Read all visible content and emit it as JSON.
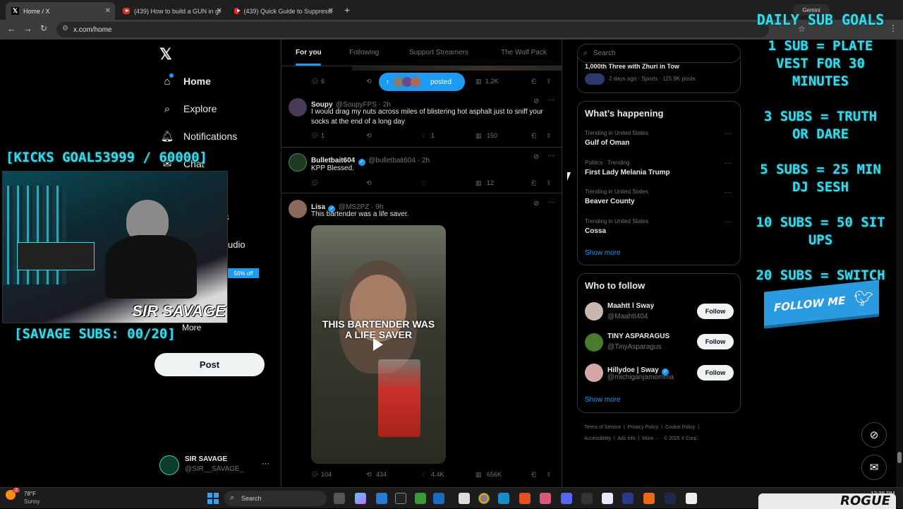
{
  "browser": {
    "tabs": [
      {
        "title": "Home / X",
        "active": true
      },
      {
        "title": "(439) How to build a GUN in gr",
        "active": false
      },
      {
        "title": "(439) Quick Guide to Suppressi",
        "active": false
      }
    ],
    "url": "x.com/home",
    "gemini_label": "Gemini"
  },
  "nav": {
    "home": "Home",
    "explore": "Explore",
    "notifications": "Notifications",
    "chat": "Chat",
    "partial_s": "s",
    "partial_udio": "udio",
    "more": "More",
    "discount_badge": "50% off",
    "post": "Post",
    "user_name": "SIR SAVAGE",
    "user_handle": "@SIR__SAVAGE_"
  },
  "feed": {
    "tabs": [
      "For you",
      "Following",
      "Support Streamers",
      "The Wolf Pack"
    ],
    "posted_pill": "posted",
    "top_actions": {
      "replies": "6",
      "views": "1.2K"
    },
    "tweets": [
      {
        "name": "Soupy",
        "handle": "@SoupyFPS · 2h",
        "text": "I would drag my nuts across miles of blistering hot asphalt just to sniff your socks at the end of a long day",
        "replies": "1",
        "reposts": "",
        "likes": "1",
        "views": "150"
      },
      {
        "name": "Bulletbait604",
        "handle": "@bulletbait604 · 2h",
        "text": "KPP Blessed.",
        "replies": "",
        "reposts": "",
        "likes": "",
        "views": "12"
      },
      {
        "name": "Lisa",
        "handle": "@MS2PZ · 9h",
        "text": "This bartender was a life saver.",
        "video_caption": "THIS BARTENDER WAS A LIFE SAVER",
        "replies": "104",
        "reposts": "434",
        "likes": "4.4K",
        "views": "656K"
      }
    ]
  },
  "right": {
    "search_placeholder": "Search",
    "top_card": {
      "title": "1,000th Three with Zhuri in Tow",
      "meta": "2 days ago · Sports · 115.9K posts"
    },
    "happening_title": "What’s happening",
    "trends": [
      {
        "meta": "Trending in United States",
        "name": "Gulf of Oman"
      },
      {
        "meta": "Politics · Trending",
        "name": "First Lady Melania Trump"
      },
      {
        "meta": "Trending in United States",
        "name": "Beaver County"
      },
      {
        "meta": "Trending in United States",
        "name": "Cossa"
      }
    ],
    "show_more": "Show more",
    "wtf_title": "Who to follow",
    "wtf": [
      {
        "name": "Maahtt l Sway",
        "handle": "@Maahtt404",
        "button": "Follow"
      },
      {
        "name": "TINY ASPARAGUS",
        "handle": "@TinyAsparagus",
        "button": "Follow"
      },
      {
        "name": "Hillydoe | Sway",
        "handle": "@michiganjamomma",
        "button": "Follow"
      }
    ],
    "wtf_show_more": "Show more",
    "footer": [
      "Terms of Service",
      "Privacy Policy",
      "Cookie Policy",
      "Accessibility",
      "Ads info",
      "More ···",
      "© 2025 X Corp."
    ]
  },
  "overlay": {
    "kicks_goal": "[KICKS GOAL53999 / 60000]",
    "savage_subs": "[SAVAGE SUBS: 00/20]",
    "webcam_caption": "SIR SAVAGE",
    "goals": [
      "DAILY SUB GOALS",
      "1 SUB = PLATE VEST FOR 30 MINUTES",
      "3 SUBS = TRUTH OR DARE",
      "5 SUBS = 25 MIN DJ SESH",
      "10 SUBS = 50 SIT UPS",
      "20 SUBS = SWITCH GAME"
    ],
    "follow_me": "FOLLOW ME",
    "rogue": "ROGUE"
  },
  "taskbar": {
    "weather_temp": "78°F",
    "weather_desc": "Sunny",
    "weather_badge": "2",
    "search": "Search",
    "time": "12:38 PM"
  }
}
